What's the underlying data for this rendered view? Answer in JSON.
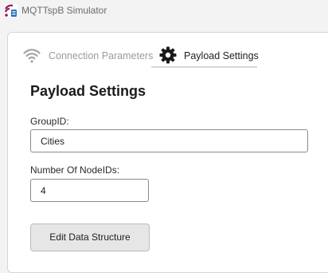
{
  "window": {
    "title": "MQTTspB Simulator",
    "icon": "app-logo-icon"
  },
  "tabs": [
    {
      "label": "Connection Parameters",
      "icon": "wifi-icon",
      "selected": false
    },
    {
      "label": "Payload Settings",
      "icon": "gear-icon",
      "selected": true
    }
  ],
  "content": {
    "title": "Payload Settings",
    "group_id": {
      "label": "GroupID:",
      "value": "Cities"
    },
    "node_count": {
      "label": "Number Of NodeIDs:",
      "value": "4"
    },
    "edit_button_label": "Edit Data Structure"
  }
}
